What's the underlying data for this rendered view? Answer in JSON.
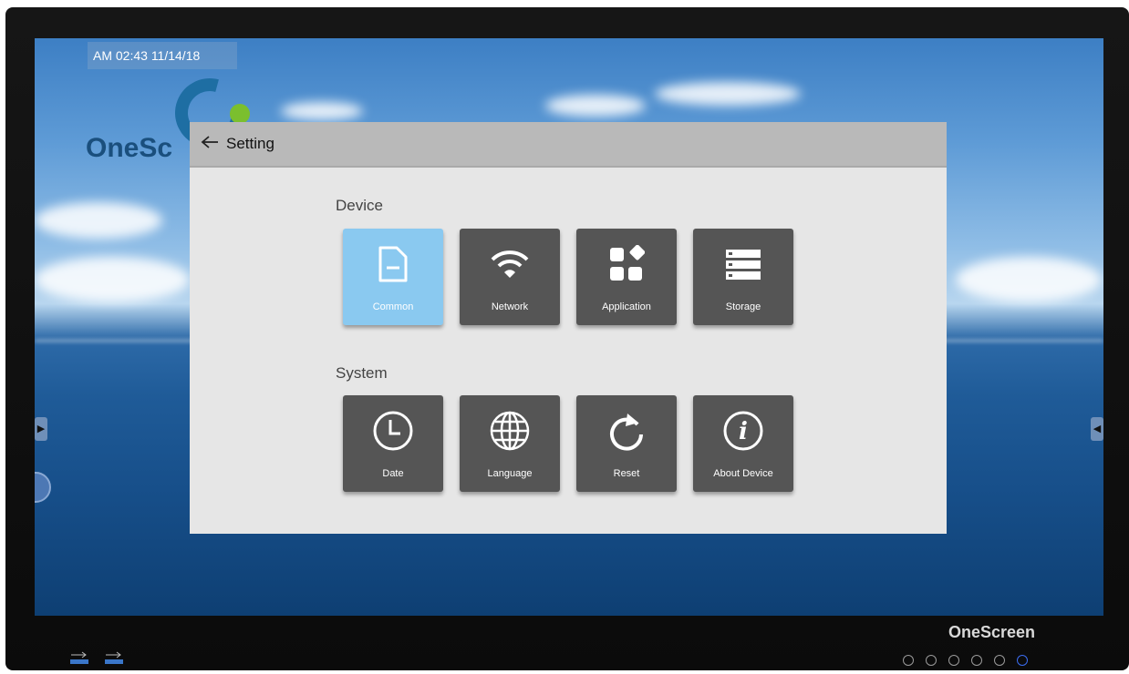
{
  "status": {
    "time_date": "AM 02:43   11/14/18"
  },
  "desktop": {
    "logo_text": "OneSc",
    "brand_bottom": "OneScreen"
  },
  "dialog": {
    "back_icon": "arrow-left-icon",
    "title": "Setting",
    "sections": [
      {
        "title": "Device",
        "items": [
          {
            "label": "Common",
            "icon": "document-icon",
            "active": true
          },
          {
            "label": "Network",
            "icon": "wifi-icon",
            "active": false
          },
          {
            "label": "Application",
            "icon": "apps-icon",
            "active": false
          },
          {
            "label": "Storage",
            "icon": "storage-icon",
            "active": false
          }
        ]
      },
      {
        "title": "System",
        "items": [
          {
            "label": "Date",
            "icon": "clock-icon",
            "active": false
          },
          {
            "label": "Language",
            "icon": "globe-icon",
            "active": false
          },
          {
            "label": "Reset",
            "icon": "reset-icon",
            "active": false
          },
          {
            "label": "About Device",
            "icon": "info-icon",
            "active": false
          }
        ]
      }
    ]
  },
  "colors": {
    "tile": "#555555",
    "tile_active": "#8ac9f0",
    "dialog_bg": "#e6e6e6",
    "header_bg": "#b9b9b9"
  }
}
